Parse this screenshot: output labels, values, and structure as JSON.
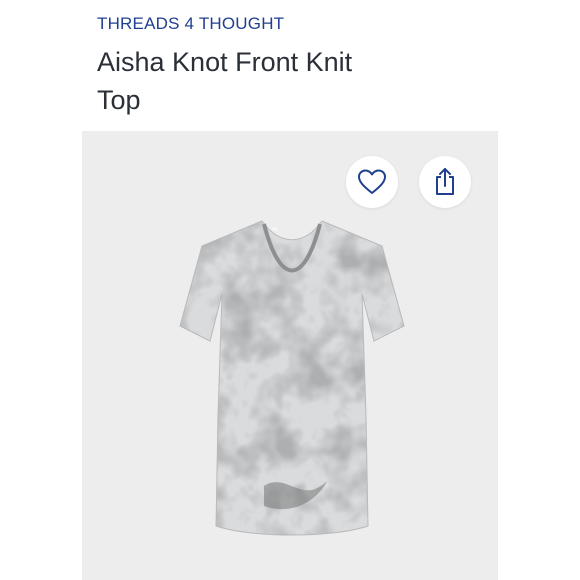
{
  "product": {
    "brand": "THREADS 4 THOUGHT",
    "name": "Aisha Knot Front Knit Top"
  },
  "icons": {
    "favorite": "heart-icon",
    "share": "share-icon"
  },
  "colors": {
    "brand": "#1f3f8f",
    "title": "#2b2f38",
    "image_background": "#ededed"
  }
}
